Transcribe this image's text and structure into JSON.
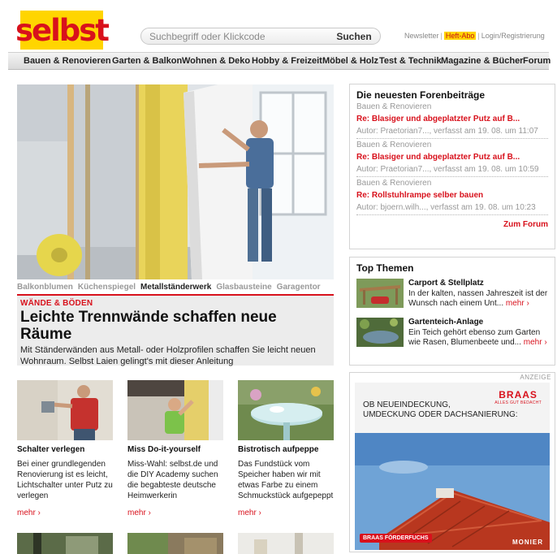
{
  "header": {
    "logo": "selbst",
    "search_placeholder": "Suchbegriff oder Klickcode",
    "search_button": "Suchen",
    "links": {
      "newsletter": "Newsletter",
      "abo": "Heft-Abo",
      "login": "Login/Registrierung"
    }
  },
  "nav": {
    "items": [
      "Bauen & Renovieren",
      "Garten & Balkon",
      "Wohnen & Deko",
      "Hobby & Freizeit",
      "Möbel & Holz",
      "Test & Technik",
      "Magazine & Bücher",
      "Forum"
    ]
  },
  "hero": {
    "tabs": [
      "Balkonblumen",
      "Küchenspiegel",
      "Metallständerwerk",
      "Glasbausteine",
      "Garagentor"
    ],
    "active_tab": "Metallständerwerk",
    "kicker": "WÄNDE & BÖDEN",
    "headline": "Leichte Trennwände schaffen neue Räume",
    "teaser": "Mit Ständerwänden aus Metall- oder Holzprofilen schaffen Sie leicht neuen Wohnraum. Selbst Laien gelingt's mit dieser Anleitung"
  },
  "cards": [
    {
      "title": "Schalter verlegen",
      "text": "Bei einer grundlegenden Renovierung ist es leicht, Lichtschalter unter Putz zu verlegen",
      "more": "mehr ›"
    },
    {
      "title": "Miss Do-it-yourself",
      "text": "Miss-Wahl: selbst.de und die DIY Academy suchen die begabteste deutsche Heimwerkerin",
      "more": "mehr ›"
    },
    {
      "title": "Bistrotisch aufpeppe",
      "text": "Das Fundstück vom Speicher haben wir mit etwas Farbe zu einem Schmuckstück aufgepeppt",
      "more": "mehr ›"
    }
  ],
  "forum": {
    "title": "Die neuesten Forenbeiträge",
    "posts": [
      {
        "category": "Bauen & Renovieren",
        "title": "Re: Blasiger und abgeplatzter Putz auf B...",
        "meta": "Autor: Praetorian7..., verfasst am 19. 08. um 11:07"
      },
      {
        "category": "Bauen & Renovieren",
        "title": "Re: Blasiger und abgeplatzter Putz auf B...",
        "meta": "Autor: Praetorian7..., verfasst am 19. 08. um 10:59"
      },
      {
        "category": "Bauen & Renovieren",
        "title": "Re: Rollstuhlrampe selber bauen",
        "meta": "Autor: bjoern.wilh..., verfasst am 19. 08. um 10:23"
      }
    ],
    "link": "Zum Forum"
  },
  "top_themen": {
    "title": "Top Themen",
    "items": [
      {
        "title": "Carport & Stellplatz",
        "text": "In der kalten, nassen Jahreszeit ist der Wunsch nach einem Unt...",
        "more": "mehr ›"
      },
      {
        "title": "Gartenteich-Anlage",
        "text": "Ein Teich gehört ebenso zum Garten wie Rasen, Blumenbeete und...",
        "more": "mehr ›"
      }
    ]
  },
  "ad": {
    "label": "ANZEIGE",
    "brand": "BRAAS",
    "brand_tagline": "ALLES GUT BEDACHT",
    "headline_1": "OB NEUEINDECKUNG,",
    "headline_2": "UMDECKUNG ODER DACHSANIERUNG:",
    "badge": "BRAAS FÖRDERFUCHS",
    "footer": "MONIER"
  },
  "colors": {
    "brand_red": "#d8111c",
    "brand_yellow": "#ffd500"
  }
}
